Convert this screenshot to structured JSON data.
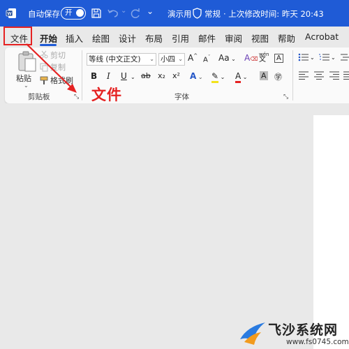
{
  "titlebar": {
    "autosave_label": "自动保存",
    "autosave_toggle": "开",
    "doc_title": "演示用",
    "sensitivity": "常规",
    "modified": "· 上次修改时间: 昨天 20:43",
    "more": "⌄"
  },
  "tabs": [
    "文件",
    "开始",
    "插入",
    "绘图",
    "设计",
    "布局",
    "引用",
    "邮件",
    "审阅",
    "视图",
    "帮助",
    "Acrobat"
  ],
  "ribbon": {
    "paste_label": "粘贴",
    "cut_label": "剪切",
    "copy_label": "复制",
    "format_painter_label": "格式刷",
    "clipboard_group": "剪贴板",
    "font_group": "字体",
    "font_name": "等线 (中文正文)",
    "font_size": "小四",
    "grow_font": "A",
    "shrink_font": "A",
    "change_case": "Aa",
    "bold": "B",
    "italic": "I",
    "underline": "U",
    "strike": "ab",
    "subscript": "x₂",
    "superscript": "x²"
  },
  "annotation": {
    "text": "文件"
  },
  "watermark": {
    "text": "飞沙系统网",
    "url": "www.fs0745.com"
  },
  "colors": {
    "titlebar": "#1f5bd6",
    "annotation": "#e52222"
  }
}
